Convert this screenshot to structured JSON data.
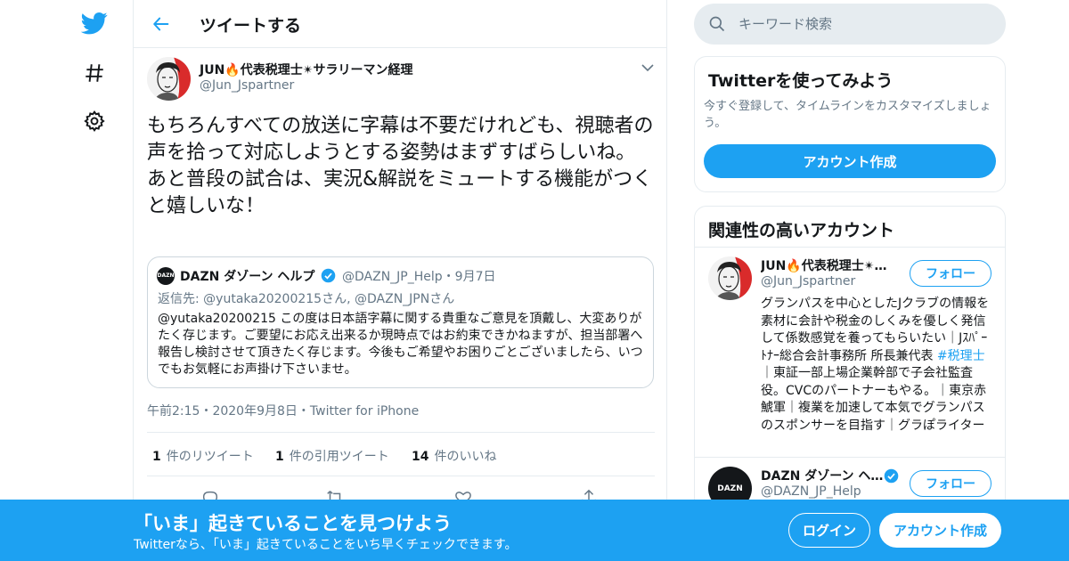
{
  "nav": {
    "icons": [
      "twitter-bird-icon",
      "explore-hashtag-icon",
      "settings-gear-icon"
    ]
  },
  "header": {
    "title": "ツイートする",
    "back_icon": "back-arrow-icon"
  },
  "tweet": {
    "author_name": "JUN🔥代表税理士✴サラリーマン経理",
    "author_handle": "@Jun_Jspartner",
    "text": "もちろんすべての放送に字幕は不要だけれども、視聴者の声を拾って対応しようとする姿勢はまずすばらしいね。\nあと普段の試合は、実況&解説をミュートする機能がつくと嬉しいな！",
    "quote": {
      "avatar_text": "DAZN",
      "author_name": "DAZN ダゾーン ヘルプ",
      "author_handle": "@DAZN_JP_Help",
      "date": "・9月7日",
      "reply_to": "返信先: @yutaka20200215さん, @DAZN_JPNさん",
      "text": "@yutaka20200215 この度は日本語字幕に関する貴重なご意見を頂戴し、大変ありがたく存じます。ご要望にお応え出来るか現時点ではお約束できかねますが、担当部署へ報告し検討させて頂きたく存じます。今後もご希望やお困りごとございましたら、いつでもお気軽にお声掛け下さいませ。"
    },
    "meta": "午前2:15・2020年9月8日・Twitter for iPhone",
    "stats": {
      "retweets_count": "1",
      "retweets_label": "件のリツイート",
      "quotes_count": "1",
      "quotes_label": "件の引用ツイート",
      "likes_count": "14",
      "likes_label": "件のいいね"
    }
  },
  "search": {
    "placeholder": "キーワード検索"
  },
  "signup_card": {
    "title": "Twitterを使ってみよう",
    "description": "今すぐ登録して、タイムラインをカスタマイズしましょう。",
    "button": "アカウント作成"
  },
  "related": {
    "title": "関連性の高いアカウント",
    "accounts": [
      {
        "name": "JUN🔥代表税理士✴サラリーマン経理",
        "handle": "@Jun_Jspartner",
        "follow": "フォロー",
        "bio_before": "グランパスを中心としたJクラブの情報を素材に会計や税金のしくみを優しく発信して係数感覚を養ってもらいたい｜Jｽﾊﾟｰﾄﾅｰ総合会計事務所 所長兼代表 ",
        "bio_tag": "#税理士",
        "bio_after": "｜東証一部上場企業幹部で子会社監査役。CVCのパートナーもやる。｜東京赤鯱軍｜複業を加速して本気でグランパスのスポンサーを目指す｜グラぽライター"
      },
      {
        "avatar_text": "DAZN",
        "name": "DAZN ダゾーン ヘルプ",
        "handle": "@DAZN_JP_Help",
        "follow": "フォロー"
      }
    ]
  },
  "banner": {
    "title": "「いま」起きていることを見つけよう",
    "subtitle": "Twitterなら、「いま」起きていることをいち早くチェックできます。",
    "login": "ログイン",
    "signup": "アカウント作成"
  },
  "colors": {
    "accent": "#1da1f2",
    "text_secondary": "#657786",
    "border": "#e6ecf0"
  }
}
